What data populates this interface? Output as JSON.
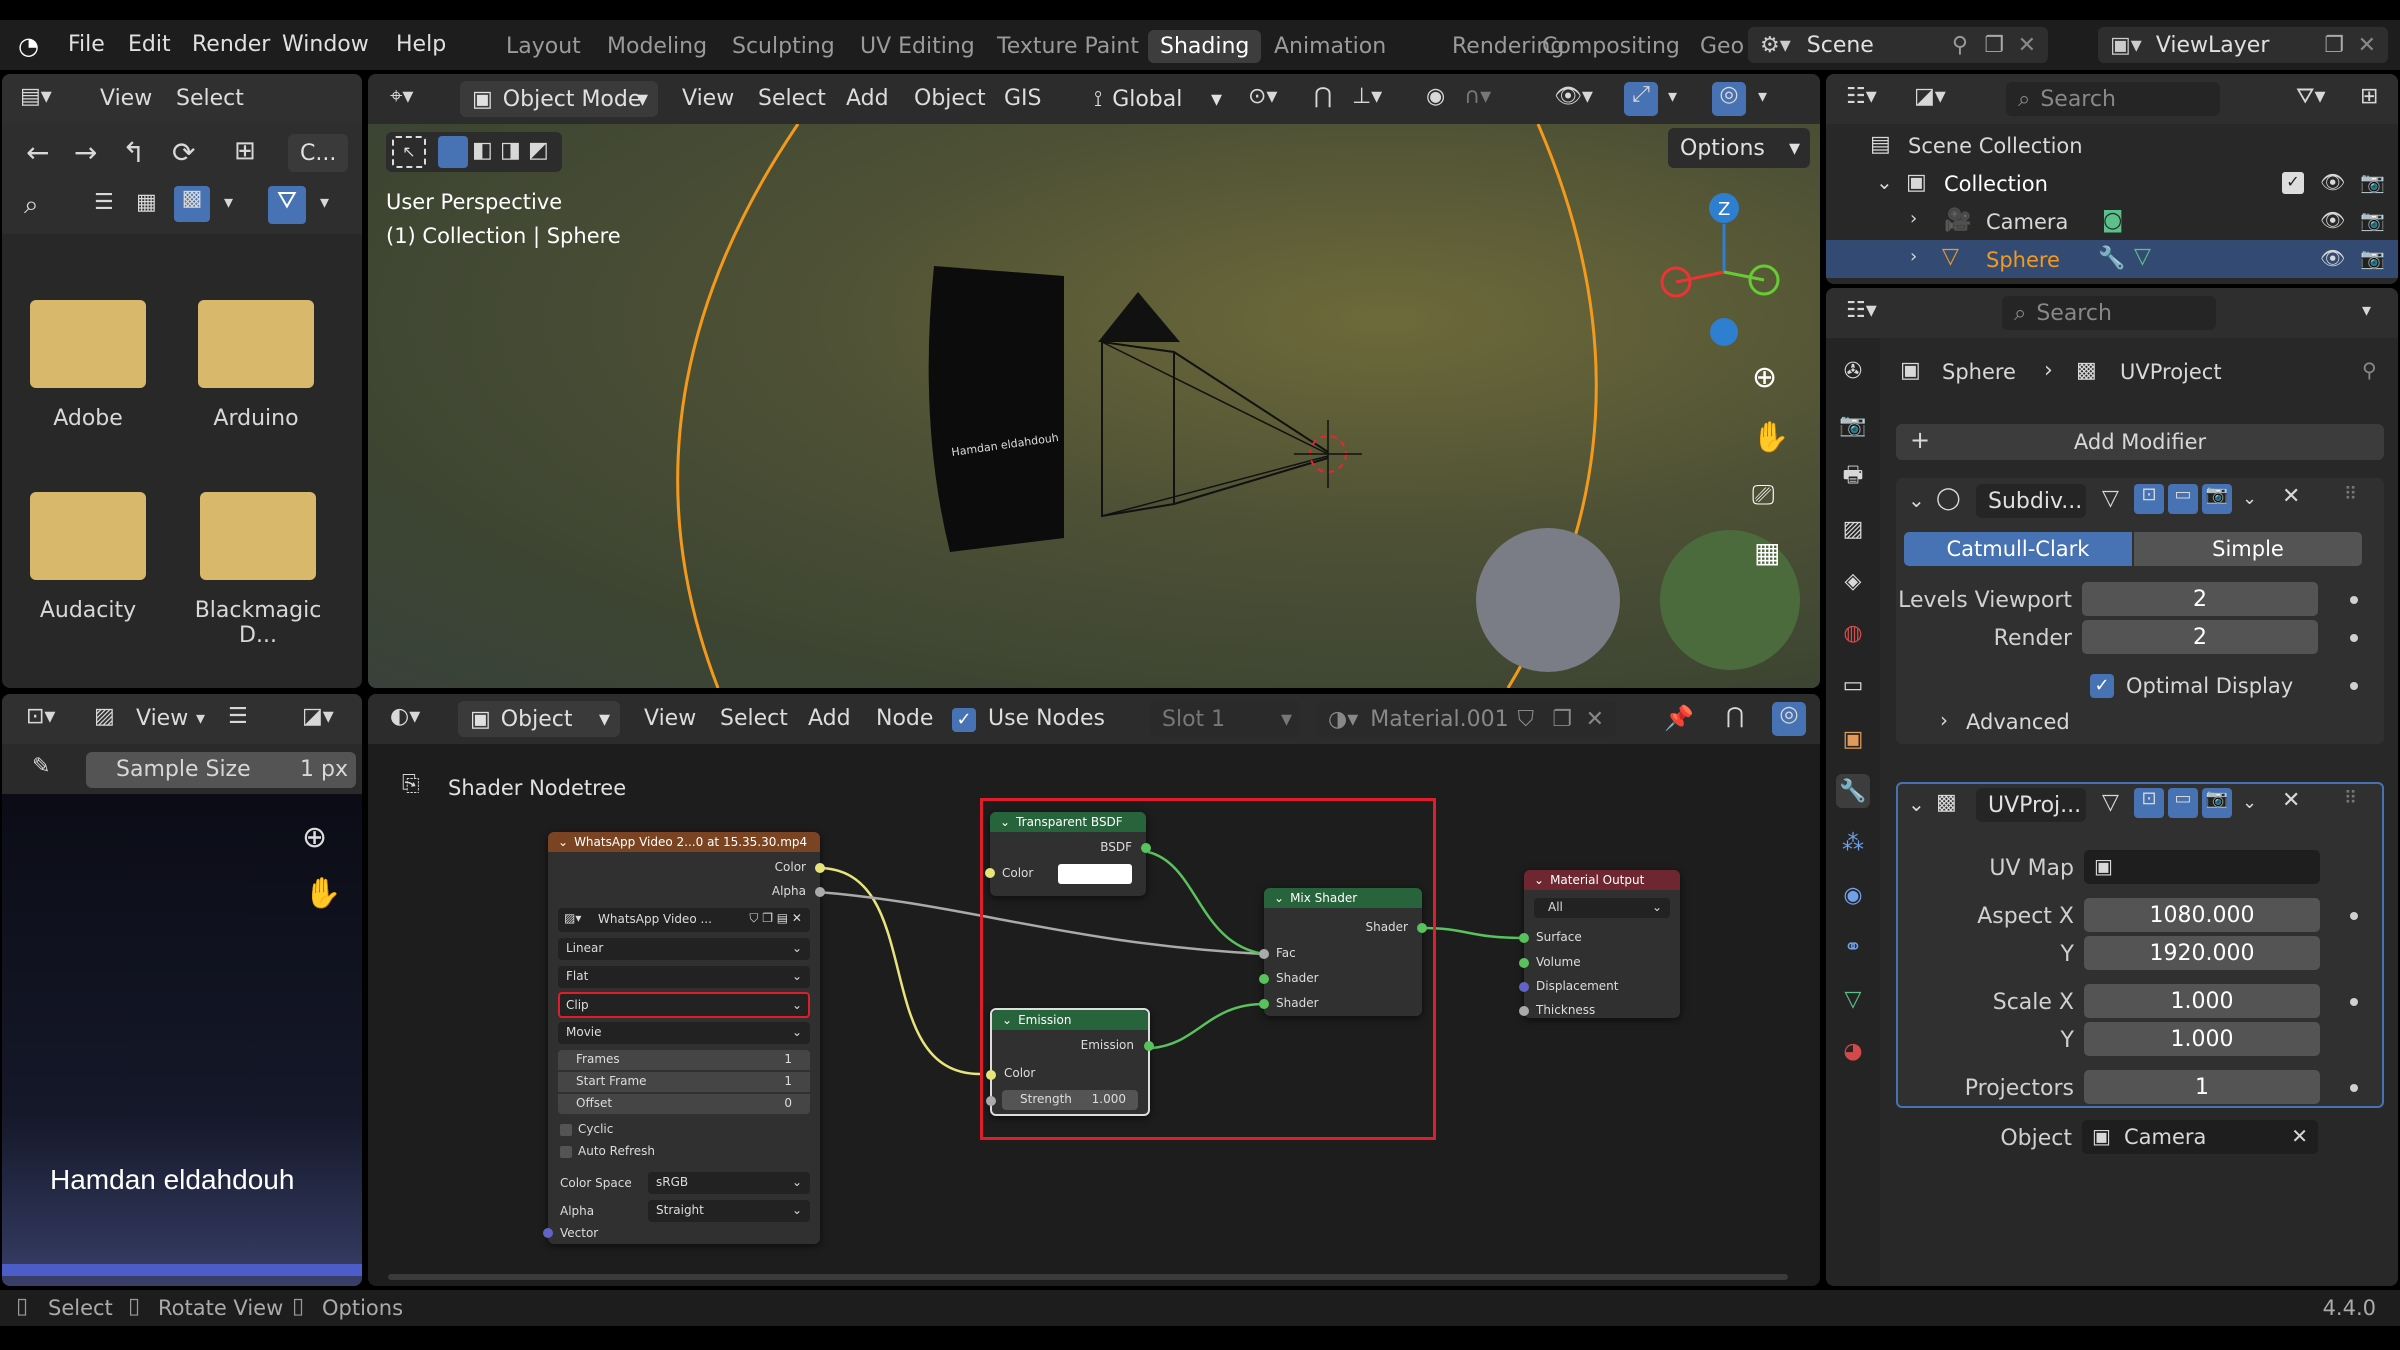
{
  "menubar": {
    "items": [
      "File",
      "Edit",
      "Render",
      "Window",
      "Help"
    ]
  },
  "workspaces": [
    "Layout",
    "Modeling",
    "Sculpting",
    "UV Editing",
    "Texture Paint",
    "Shading",
    "Animation",
    "Rendering",
    "Compositing",
    "Geo"
  ],
  "active_workspace": "Shading",
  "scene": {
    "name": "Scene",
    "view_layer": "ViewLayer"
  },
  "file_browser": {
    "menu": [
      "View",
      "Select"
    ],
    "path_btn": "C...",
    "folders": [
      "Adobe",
      "Arduino",
      "Audacity",
      "Blackmagic D..."
    ]
  },
  "image_editor": {
    "view_label": "View",
    "sample_size_label": "Sample Size",
    "sample_size_value": "1 px",
    "overlay_text": "Hamdan eldahdouh"
  },
  "viewport": {
    "mode": "Object Mode",
    "menus": [
      "View",
      "Select",
      "Add",
      "Object",
      "GIS"
    ],
    "orientation": "Global",
    "options": "Options",
    "info_line1": "User Perspective",
    "info_line2": "(1) Collection | Sphere",
    "gizmo_z": "Z",
    "screen_text": "Hamdan eldahdouh"
  },
  "shader_editor": {
    "type": "Object",
    "menus": [
      "View",
      "Select",
      "Add",
      "Node"
    ],
    "use_nodes": "Use Nodes",
    "slot": "Slot 1",
    "material": "Material.001",
    "breadcrumb": "Shader Nodetree",
    "image_node": {
      "title": "WhatsApp Video 2...0 at 15.35.30.mp4",
      "out_color": "Color",
      "out_alpha": "Alpha",
      "image_name": "WhatsApp Video ...",
      "interp": "Linear",
      "proj": "Flat",
      "ext": "Clip",
      "source": "Movie",
      "frames_label": "Frames",
      "frames_val": "1",
      "start_label": "Start Frame",
      "start_val": "1",
      "offset_label": "Offset",
      "offset_val": "0",
      "cyclic": "Cyclic",
      "auto_refresh": "Auto Refresh",
      "colorspace_label": "Color Space",
      "colorspace_val": "sRGB",
      "alpha_label": "Alpha",
      "alpha_val": "Straight",
      "vector": "Vector"
    },
    "transparent_node": {
      "title": "Transparent BSDF",
      "out": "BSDF",
      "color": "Color"
    },
    "emission_node": {
      "title": "Emission",
      "out": "Emission",
      "color": "Color",
      "strength_label": "Strength",
      "strength_val": "1.000"
    },
    "mix_node": {
      "title": "Mix Shader",
      "out": "Shader",
      "fac": "Fac",
      "s1": "Shader",
      "s2": "Shader"
    },
    "output_node": {
      "title": "Material Output",
      "target": "All",
      "surface": "Surface",
      "volume": "Volume",
      "displacement": "Displacement",
      "thickness": "Thickness"
    }
  },
  "outliner": {
    "search_placeholder": "Search",
    "root": "Scene Collection",
    "collection": "Collection",
    "items": [
      "Camera",
      "Sphere"
    ]
  },
  "properties": {
    "search_placeholder": "Search",
    "breadcrumb_object": "Sphere",
    "breadcrumb_modifier": "UVProject",
    "add_modifier": "Add Modifier",
    "subdiv": {
      "name": "Subdiv...",
      "catmull": "Catmull-Clark",
      "simple": "Simple",
      "levels_viewport_label": "Levels Viewport",
      "levels_viewport_val": "2",
      "render_label": "Render",
      "render_val": "2",
      "optimal_display": "Optimal Display",
      "advanced": "Advanced"
    },
    "uvproject": {
      "name": "UVProj...",
      "uvmap_label": "UV Map",
      "aspect_x_label": "Aspect X",
      "aspect_x_val": "1080.000",
      "aspect_y_label": "Y",
      "aspect_y_val": "1920.000",
      "scale_x_label": "Scale X",
      "scale_x_val": "1.000",
      "scale_y_label": "Y",
      "scale_y_val": "1.000",
      "projectors_label": "Projectors",
      "projectors_val": "1",
      "object_label": "Object",
      "object_val": "Camera"
    }
  },
  "statusbar": {
    "select": "Select",
    "rotate": "Rotate View",
    "options": "Options",
    "version": "4.4.0"
  },
  "colors": {
    "accent": "#4772b3",
    "orange": "#f39a1c",
    "highlight_red": "#e01e2b",
    "node_green": "#27643c",
    "node_red": "#6e2630",
    "image_node": "#7a4321"
  }
}
